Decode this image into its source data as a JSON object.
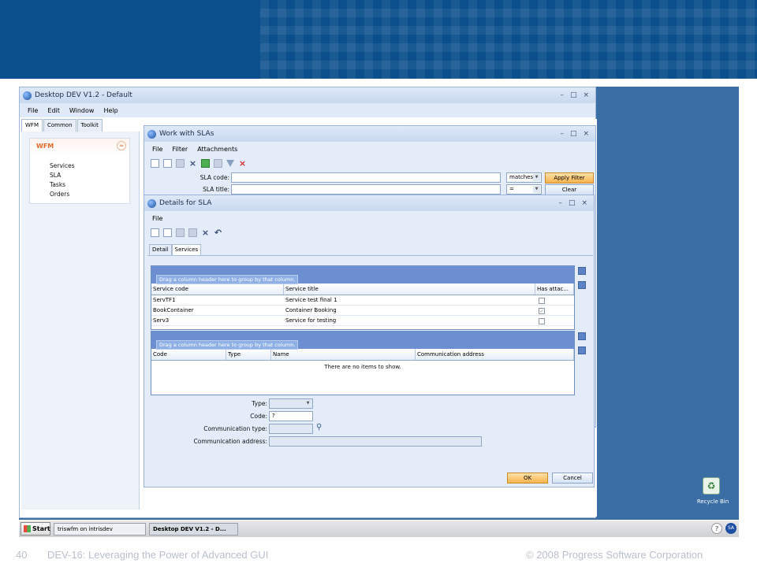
{
  "app": {
    "title": "Desktop DEV V1.2 - Default",
    "win_min": "–",
    "win_max": "□",
    "win_close": "×",
    "menu": [
      "File",
      "Edit",
      "Window",
      "Help"
    ]
  },
  "left_tabs": [
    "WFM",
    "Common",
    "Toolkit"
  ],
  "nav": {
    "header": "WFM",
    "chevron": "≈",
    "items": [
      "Services",
      "SLA",
      "Tasks",
      "Orders"
    ]
  },
  "sla_window": {
    "title": "Work with SLAs",
    "menu": [
      "File",
      "Filter",
      "Attachments"
    ],
    "sla_code_label": "SLA code:",
    "sla_title_label": "SLA title:",
    "match_mode": "matches",
    "match_mode_2": "=",
    "apply_filter": "Apply Filter",
    "clear": "Clear"
  },
  "details_window": {
    "title": "Details for SLA",
    "menu": [
      "File"
    ],
    "tabs": [
      "Detail",
      "Services"
    ],
    "grid1": {
      "group_hint": "Drag a column header here to group by that column.",
      "columns": [
        "Service code",
        "Service title",
        "Has attac..."
      ],
      "rows": [
        {
          "code": "ServTF1",
          "title": "Service test final 1",
          "checked": false
        },
        {
          "code": "BookContainer",
          "title": "Container Booking",
          "checked": true
        },
        {
          "code": "Serv3",
          "title": "Service for testing",
          "checked": false
        }
      ]
    },
    "grid2": {
      "group_hint": "Drag a column header here to group by that column.",
      "columns": [
        "Code",
        "Type",
        "Name",
        "Communication address"
      ],
      "empty_text": "There are no items to show."
    },
    "form": {
      "type_label": "Type:",
      "code_label": "Code:",
      "code_value": "?",
      "comm_type_label": "Communication type:",
      "comm_address_label": "Communication address:"
    },
    "ok": "OK",
    "cancel": "Cancel"
  },
  "desktop": {
    "recycle_bin": "Recycle Bin"
  },
  "taskbar": {
    "start": "Start",
    "items": [
      "triswfm on intrisdev",
      "Desktop DEV V1.2 - D..."
    ],
    "tray": [
      "?",
      "SA"
    ]
  },
  "footer": {
    "page": "40",
    "title": "DEV-16: Leveraging the Power of Advanced GUI",
    "copyright": "© 2008 Progress Software Corporation"
  }
}
